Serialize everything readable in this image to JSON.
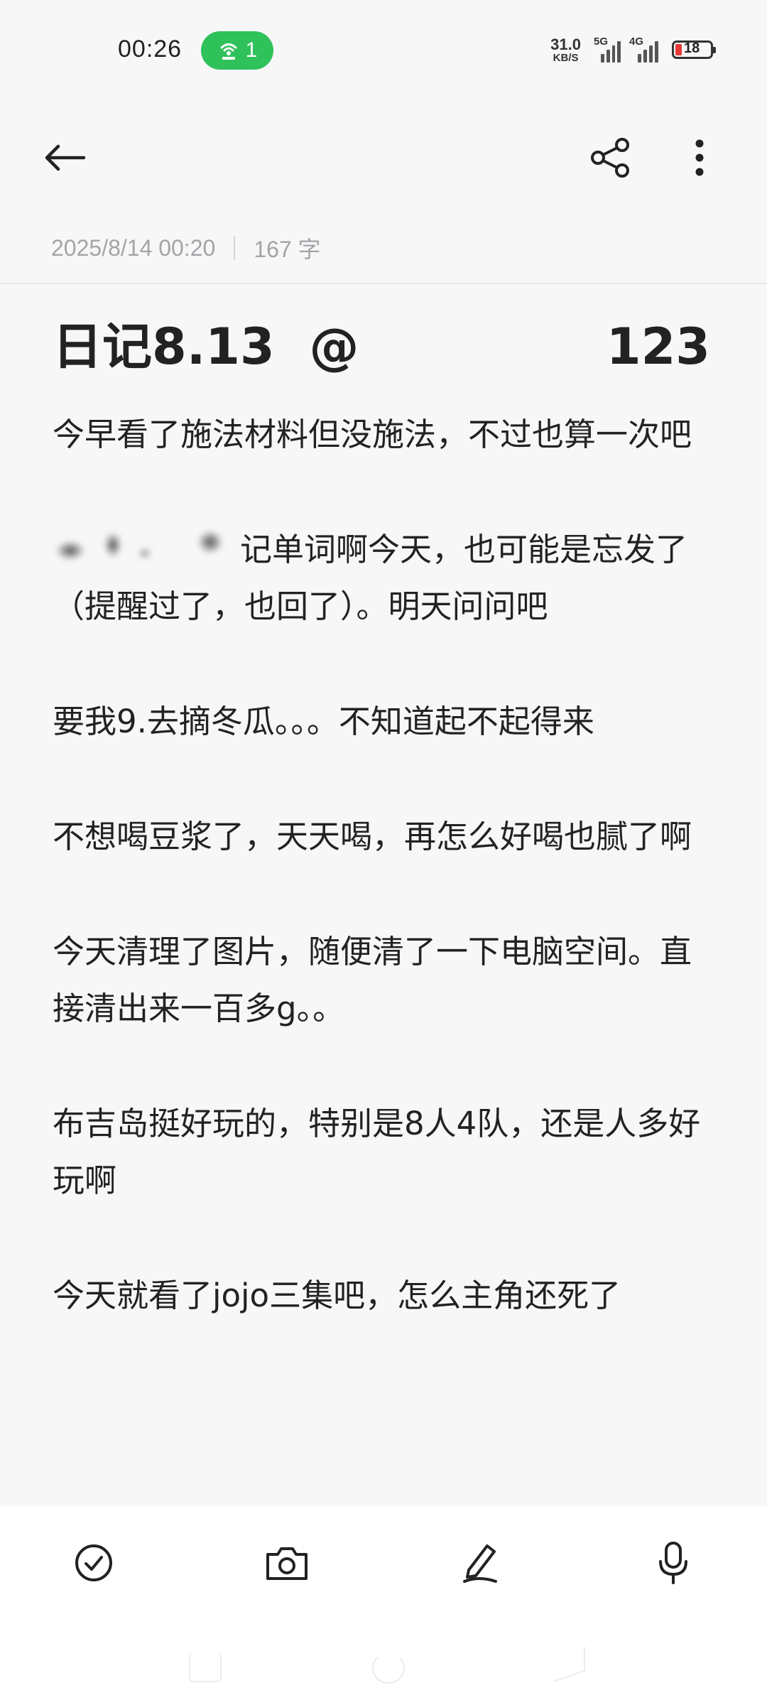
{
  "status_bar": {
    "time": "00:26",
    "hotspot_count": "1",
    "net_speed_value": "31.0",
    "net_speed_unit": "KB/S",
    "signal1_label": "5G",
    "signal2_label": "4G",
    "battery_level": "18",
    "hotspot_color": "#2fc15a",
    "battery_color": "#e53935"
  },
  "header": {
    "back_icon": "arrow-left-icon",
    "share_icon": "share-icon",
    "more_icon": "more-vertical-icon"
  },
  "meta": {
    "datetime": "2025/8/14 00:20",
    "word_count": "167 字"
  },
  "note": {
    "title": "日记8.13  @",
    "title_right": "123",
    "paragraphs": [
      "今早看了施法材料但没施法，不过也算一次吧",
      "记单词啊今天，也可能是忘发了（提醒过了，也回了）。明天问问吧",
      "要我9.去摘冬瓜。。。不知道起不起得来",
      "不想喝豆浆了，天天喝，再怎么好喝也腻了啊",
      "今天清理了图片，随便清了一下电脑空间。直接清出来一百多g。。",
      "布吉岛挺好玩的，特别是8人4队，还是人多好玩啊",
      "今天就看了jojo三集吧，怎么主角还死了"
    ]
  },
  "toolbar": {
    "icons": [
      "checklist-icon",
      "camera-icon",
      "pen-icon",
      "microphone-icon"
    ]
  }
}
